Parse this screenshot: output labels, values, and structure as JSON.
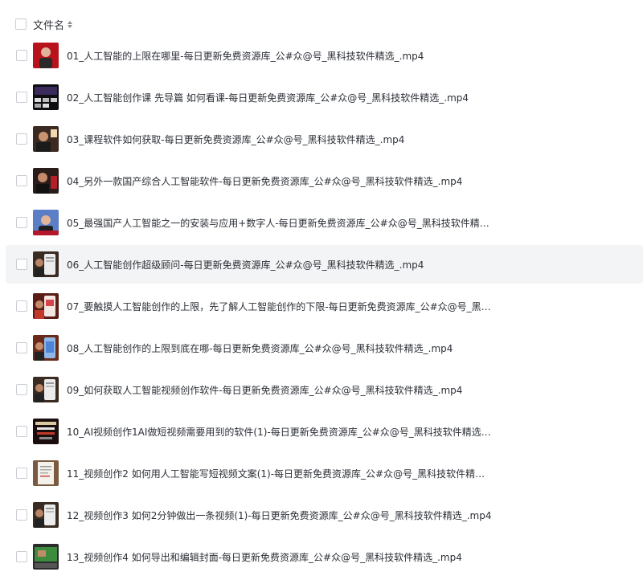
{
  "header": {
    "title": "文件名"
  },
  "files": [
    {
      "name": "01_人工智能的上限在哪里-每日更新免费资源库_公#众@号_黑科技软件精选_.mp4",
      "thumb": "person-red-background"
    },
    {
      "name": "02_人工智能创作课 先导篇 如何看课-每日更新免费资源库_公#众@号_黑科技软件精选_.mp4",
      "thumb": "dark-grid-screens"
    },
    {
      "name": "03_课程软件如何获取-每日更新免费资源库_公#众@号_黑科技软件精选_.mp4",
      "thumb": "dark-scene"
    },
    {
      "name": "04_另外一款国产综合人工智能软件-每日更新免费资源库_公#众@号_黑科技软件精选_.mp4",
      "thumb": "dark-scene-red"
    },
    {
      "name": "05_最强国产人工智能之一的安装与应用+数字人-每日更新免费资源库_公#众@号_黑科技软件精选…",
      "thumb": "person-blue-background"
    },
    {
      "name": "06_人工智能创作超级顾问-每日更新免费资源库_公#众@号_黑科技软件精选_.mp4",
      "thumb": "phone-screen-dark"
    },
    {
      "name": "07_要触摸人工智能创作的上限，先了解人工智能创作的下限-每日更新免费资源库_公#众@号_黑…",
      "thumb": "phone-screen-red"
    },
    {
      "name": "08_人工智能创作的上限到底在哪-每日更新免费资源库_公#众@号_黑科技软件精选_.mp4",
      "thumb": "phone-screen-blue"
    },
    {
      "name": "09_如何获取人工智能视频创作软件-每日更新免费资源库_公#众@号_黑科技软件精选_.mp4",
      "thumb": "phone-screen-dark"
    },
    {
      "name": "10_AI视频创作1AI做短视频需要用到的软件(1)-每日更新免费资源库_公#众@号_黑科技软件精选_.…",
      "thumb": "dark-poster"
    },
    {
      "name": "11_视频创作2 如何用人工智能写短视频文案(1)-每日更新免费资源库_公#众@号_黑科技软件精选_.…",
      "thumb": "paper-document"
    },
    {
      "name": "12_视频创作3 如何2分钟做出一条视频(1)-每日更新免费资源库_公#众@号_黑科技软件精选_.mp4",
      "thumb": "phone-screen-dark"
    },
    {
      "name": "13_视频创作4 如何导出和编辑封面-每日更新免费资源库_公#众@号_黑科技软件精选_.mp4",
      "thumb": "green-screen"
    }
  ],
  "hovered_row": 5
}
